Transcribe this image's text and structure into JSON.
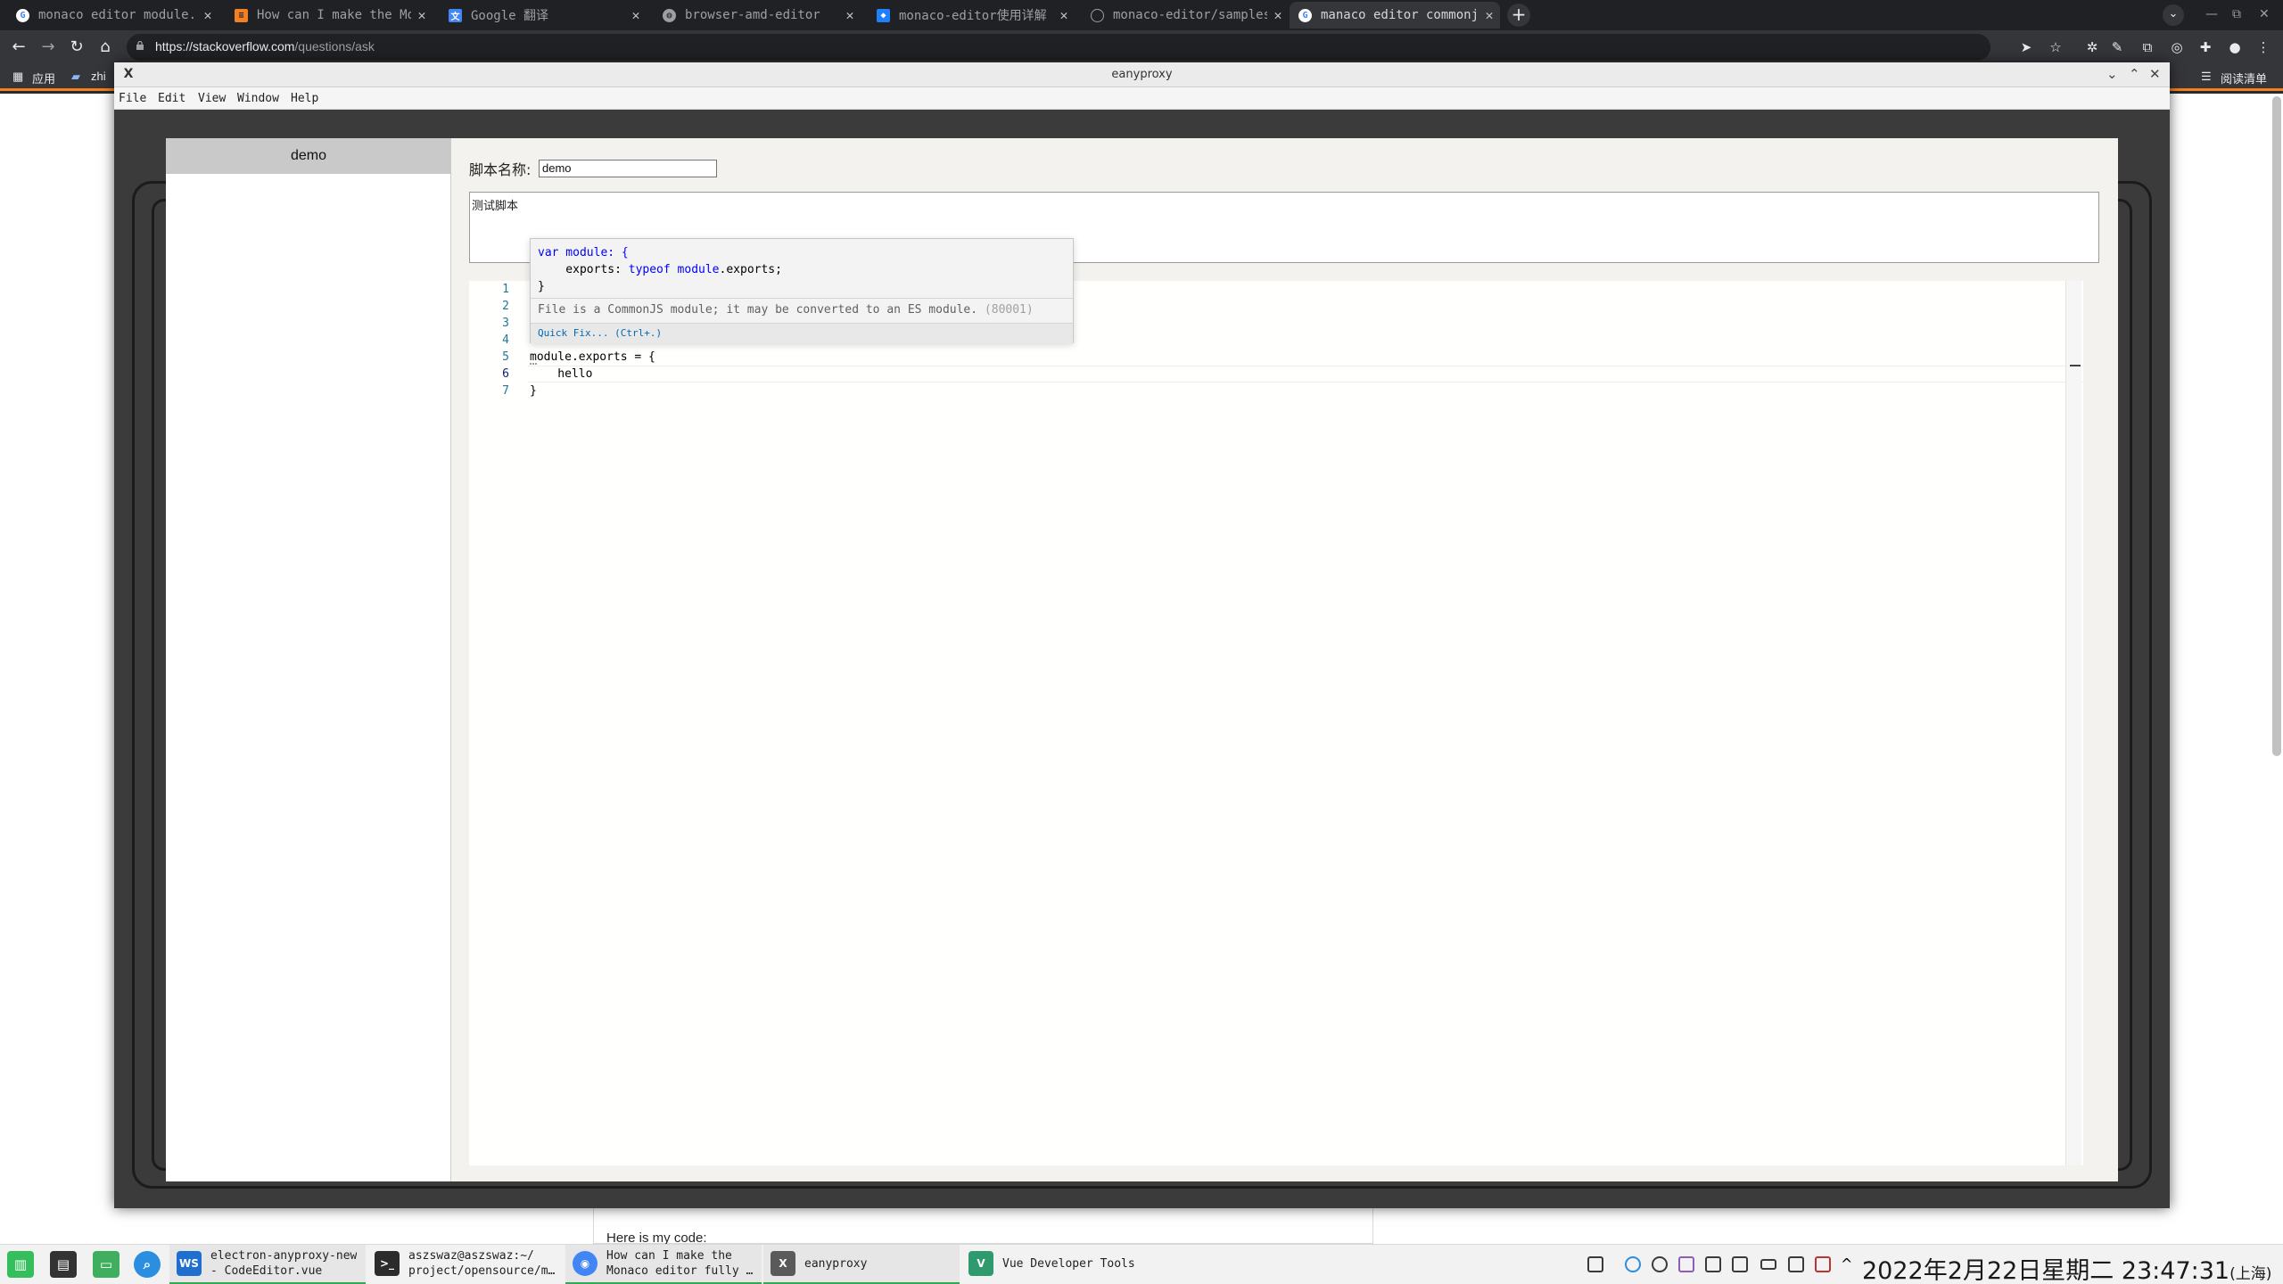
{
  "browser": {
    "tabs": [
      {
        "title": "monaco editor module.",
        "icon": "google-icon",
        "active": false
      },
      {
        "title": "How can I make the Mo",
        "icon": "stackoverflow-icon",
        "active": false
      },
      {
        "title": "Google 翻译",
        "icon": "google-translate-icon",
        "active": false
      },
      {
        "title": "browser-amd-editor",
        "icon": "globe-icon",
        "active": false
      },
      {
        "title": "monaco-editor使用详解",
        "icon": "juejin-icon",
        "active": false
      },
      {
        "title": "monaco-editor/samples",
        "icon": "github-icon",
        "active": false
      },
      {
        "title": "manaco editor commonj",
        "icon": "google-icon",
        "active": true
      }
    ],
    "url_host": "https://stackoverflow.com",
    "url_path": "/questions/ask",
    "bookmarks": {
      "apps": "应用",
      "zhi": "zhi",
      "reading_list": "阅读清单"
    }
  },
  "app": {
    "window_title": "eanyproxy",
    "menu": [
      "File",
      "Edit",
      "View",
      "Window",
      "Help"
    ],
    "sidebar_items": [
      "demo"
    ],
    "name_label": "脚本名称:",
    "name_value": "demo",
    "description": "测试脚本",
    "editor": {
      "line_numbers": [
        "1",
        "2",
        "3",
        "4",
        "5",
        "6",
        "7"
      ],
      "lines": [
        "",
        "",
        "",
        "",
        "module.exports = {",
        "    hello",
        "}"
      ],
      "current_line": 6
    },
    "hover": {
      "code_kw_var": "var",
      "code_l1": " module: {",
      "code_l2_pre": "    exports: ",
      "code_kw_typeof": "typeof",
      "code_l2_mid": " module",
      "code_l2_post": ".exports;",
      "code_l3": "}",
      "message": "File is a CommonJS module; it may be converted to an ES module.",
      "code": "(80001)",
      "action": "Quick Fix... (Ctrl+.)"
    }
  },
  "page": {
    "snippet": "Here is my code:"
  },
  "taskbar": {
    "tasks": [
      {
        "label": "electron-anyproxy-new\n- CodeEditor.vue",
        "icon": "webstorm-icon",
        "color": "#1f6fd1",
        "active": true
      },
      {
        "label": "aszswaz@aszswaz:~/\nproject/opensource/m…",
        "icon": "terminal-icon",
        "color": "#2b2b2b",
        "active": false
      },
      {
        "label": "How can I make the\nMonaco editor fully …",
        "icon": "chrome-icon",
        "color": "#4285f4",
        "active": true
      },
      {
        "label": "eanyproxy",
        "icon": "x-window-icon",
        "color": "#5a5a5a",
        "active": true
      },
      {
        "label": "Vue Developer Tools",
        "icon": "vue-icon",
        "color": "#2f9a6d",
        "active": false
      }
    ],
    "clock": "2022年2月22日星期二 23:47:31",
    "timezone": "(上海)"
  },
  "colors": {
    "accent": "#f48024",
    "active_tab": "#35363a",
    "chrome_dark": "#202124"
  }
}
